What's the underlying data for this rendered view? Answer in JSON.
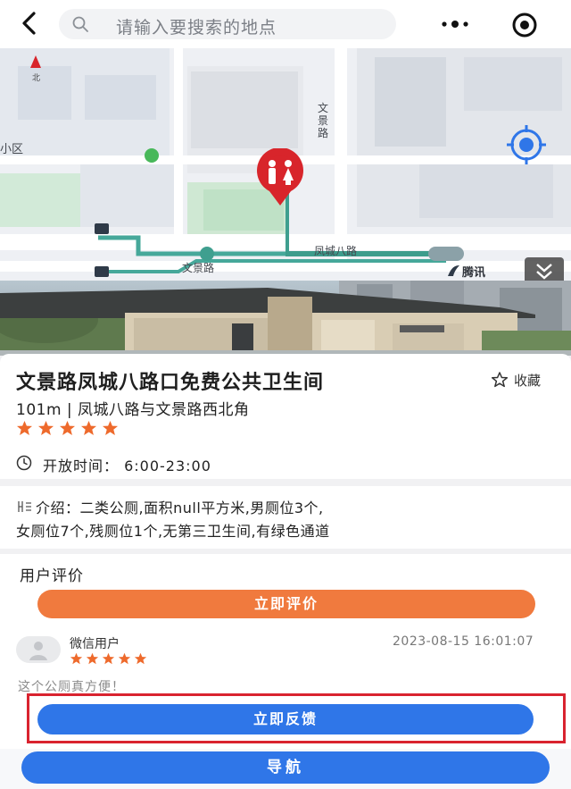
{
  "topbar": {
    "search_placeholder": "请输入要搜索的地点",
    "icons": {
      "back": "back-arrow-icon",
      "search": "search-icon",
      "more": "more-dots-icon",
      "target": "target-icon"
    }
  },
  "map": {
    "street_wenjing_vertical": "文景路",
    "street_fengcheng": "凤城八路",
    "street_wenjing": "文景路",
    "poi_xiaoqu": "小区",
    "north_label": "北",
    "tencent_logo": "腾讯",
    "icons": {
      "locate": "locate-icon",
      "toilet_pin": "toilet-pin-icon",
      "collapse": "chevron-down-icon"
    },
    "colors": {
      "pin": "#d8252b",
      "locate": "#2f76e8"
    }
  },
  "place": {
    "title": "文景路凤城八路口免费公共卫生间",
    "favorite_label": "收藏",
    "address": "101m | 凤城八路与文景路西北角",
    "rating_stars": 5,
    "hours_label": "开放时间：  6:00-23:00"
  },
  "intro": {
    "line1": "介绍：二类公厕,面积null平方米,男厕位3个,",
    "line2": "女厕位7个,残厕位1个,无第三卫生间,有绿色通道"
  },
  "reviews": {
    "heading": "用户评价",
    "rate_button": "立即评价",
    "items": [
      {
        "user": "微信用户",
        "time": "2023-08-15 16:01:07",
        "stars": 5,
        "text": "这个公厕真方便！"
      }
    ]
  },
  "actions": {
    "feedback_button": "立即反馈",
    "navigate_button": "导航"
  },
  "colors": {
    "accent_orange": "#f07a3e",
    "accent_blue": "#2f76e8",
    "star": "#ee6a2c",
    "highlight_border": "#d9232f"
  }
}
